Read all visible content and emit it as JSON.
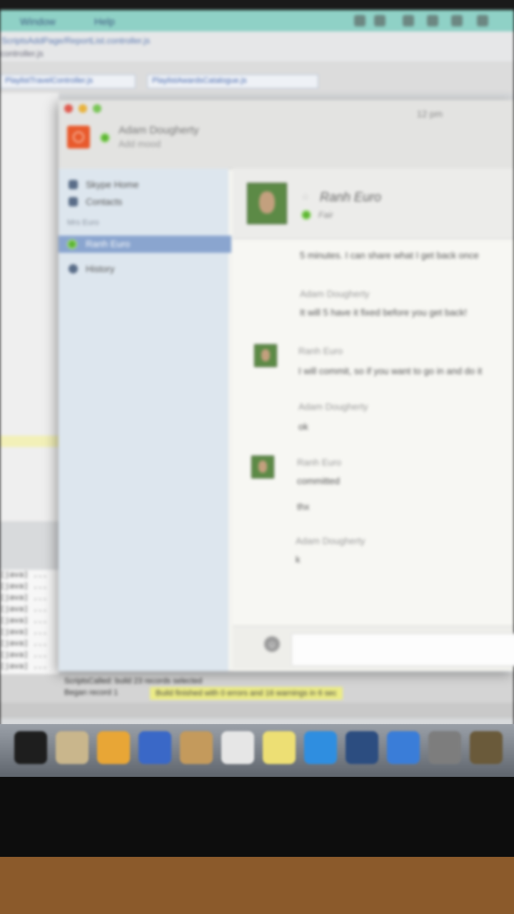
{
  "ide": {
    "menu": [
      "Window",
      "Help"
    ],
    "path_text": "ScriptsAddPage/ReportList.controller.js",
    "path_sub": "controller.js",
    "tabs": [
      "PlaylistTravelController.js",
      "PlaylistAwardsCatalogue.js"
    ],
    "console_lines": [
      "[java] ...",
      "[java] ...",
      "[java] ...",
      "[java] ...",
      "[java] ...",
      "[java] ...",
      "[java] ...",
      "[java] ...",
      "[java] ...",
      "[java] ..."
    ],
    "status_line1": "ScriptsCalled: build 23 records selected",
    "status_line2": "Began record 1",
    "warning": "Build finished with 0 errors and 16 warnings in 6 sec"
  },
  "chat": {
    "time": "12 pm",
    "self_name": "Adam Dougherty",
    "self_mood": "Add mood",
    "sidebar": {
      "items": [
        {
          "label": "Skype Home",
          "icon": "home-icon"
        },
        {
          "label": "Contacts",
          "icon": "contacts-icon"
        }
      ],
      "section": "Mrs Euro",
      "selected": "Ranh Euro",
      "history": "History"
    },
    "contact": {
      "name": "Ranh Euro",
      "status": "Fair"
    },
    "messages": [
      {
        "sender": "",
        "text": "5 minutes. I can share what I get back once"
      },
      {
        "sender": "Adam Dougherty",
        "text": "It will 5 have it fixed before you get back!"
      },
      {
        "sender": "Ranh Euro",
        "text": "I will commit, so if you want to go in and do it"
      },
      {
        "sender": "Adam Dougherty",
        "text": "ok"
      },
      {
        "sender": "Ranh Euro",
        "text": "committed"
      },
      {
        "sender": "",
        "text": "thx"
      },
      {
        "sender": "Adam Dougherty",
        "text": "k"
      }
    ],
    "composer_icon": "emoticon-icon"
  },
  "dock": {
    "icons": [
      {
        "name": "terminal-icon",
        "color": "#1e1e1e"
      },
      {
        "name": "script-editor-icon",
        "color": "#c9b68c"
      },
      {
        "name": "flower-icon",
        "color": "#e8a636"
      },
      {
        "name": "xcode-icon",
        "color": "#3a68c7"
      },
      {
        "name": "notes-icon",
        "color": "#c49a5c"
      },
      {
        "name": "calendar-icon",
        "color": "#e6e6e6"
      },
      {
        "name": "stickies-icon",
        "color": "#eddf74"
      },
      {
        "name": "skype-icon",
        "color": "#2f8ee0"
      },
      {
        "name": "checkmark-app-icon",
        "color": "#2c4d80"
      },
      {
        "name": "safari-icon",
        "color": "#3a7dd8"
      },
      {
        "name": "utilities-icon",
        "color": "#7d7d7d"
      },
      {
        "name": "automator-icon",
        "color": "#6a5a3a"
      }
    ]
  }
}
